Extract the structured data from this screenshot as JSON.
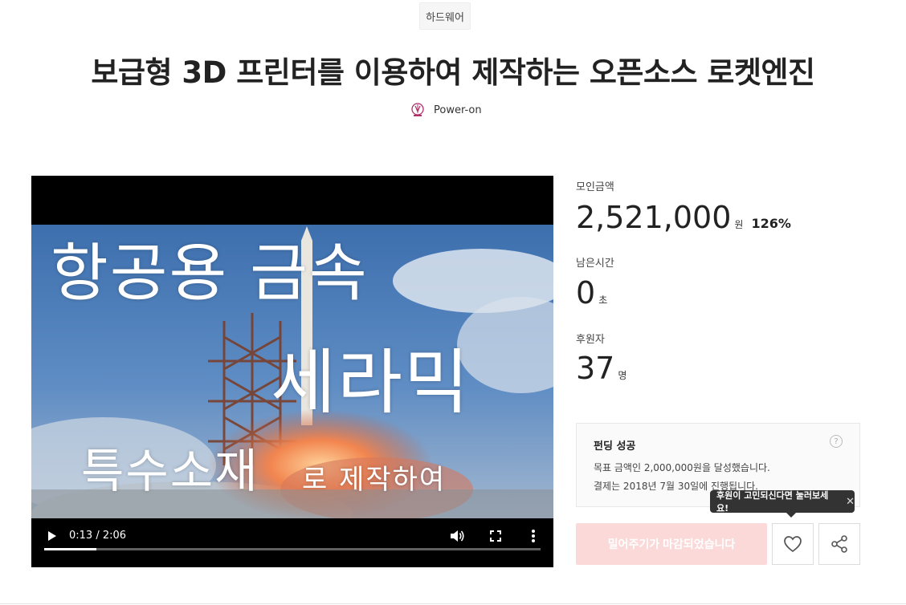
{
  "project": {
    "category": "하드웨어",
    "title": "보급형 3D 프린터를 이용하여 제작하는 오픈소스 로켓엔진",
    "maker_name": "Power-on"
  },
  "video": {
    "overlay_line1": "항공용 금속",
    "overlay_line2": "세라믹",
    "overlay_line3": "특수소재",
    "overlay_line4": "로 제작하여",
    "time": "0:13 / 2:06",
    "progress": 0.105
  },
  "stats": {
    "amount_label": "모인금액",
    "amount_value": "2,521,000",
    "amount_unit": "원",
    "amount_percent": "126%",
    "time_label": "남은시간",
    "time_value": "0",
    "time_unit": "초",
    "backers_label": "후원자",
    "backers_value": "37",
    "backers_unit": "명"
  },
  "status_box": {
    "title": "펀딩 성공",
    "line1": "목표 금액인 2,000,000원을 달성했습니다.",
    "line2": "결제는 2018년 7월 30일에 진행됩니다.",
    "help_glyph": "?"
  },
  "tooltip": {
    "text": "후원이 고민되신다면 눌러보세요!",
    "close_glyph": "✕"
  },
  "actions": {
    "cta_label": "밀어주기가 마감되었습니다",
    "like_icon": "heart-icon",
    "share_icon": "share-icon"
  },
  "colors": {
    "cta_background": "#fbd9d9",
    "tooltip_background": "#333333"
  }
}
